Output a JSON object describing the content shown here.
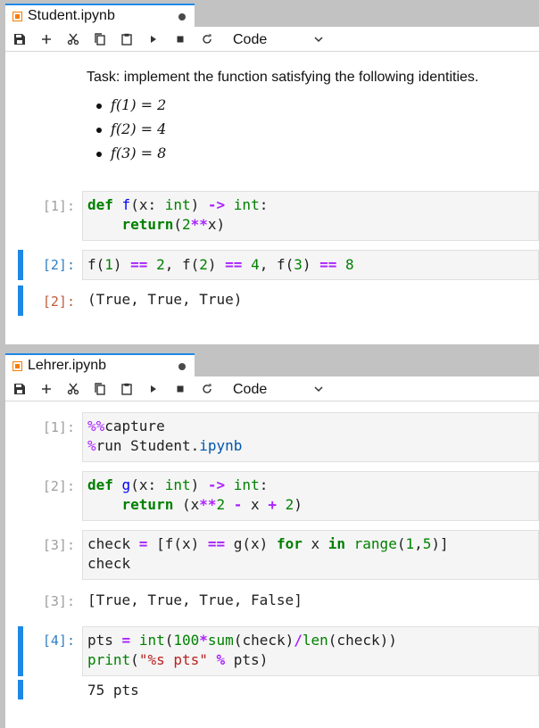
{
  "top": {
    "tab": {
      "label": "Student.ipynb"
    },
    "celltype": "Code",
    "markdown": {
      "task": "Task: implement the function satisfying the following identities.",
      "items": [
        "f(1) = 2",
        "f(2) = 4",
        "f(3) = 8"
      ]
    },
    "cells": [
      {
        "prompt": "[1]:",
        "lines": [
          "def f(x: int) -> int:",
          "    return(2**x)"
        ]
      },
      {
        "prompt": "[2]:",
        "lines": [
          "f(1) == 2, f(2) == 4, f(3) == 8"
        ],
        "out_prompt": "[2]:",
        "output": "(True, True, True)"
      }
    ]
  },
  "bottom": {
    "tab": {
      "label": "Lehrer.ipynb"
    },
    "celltype": "Code",
    "cells": [
      {
        "prompt": "[1]:",
        "lines": [
          "%%capture",
          "%run Student.ipynb"
        ]
      },
      {
        "prompt": "[2]:",
        "lines": [
          "def g(x: int) -> int:",
          "    return (x**2 - x + 2)"
        ]
      },
      {
        "prompt": "[3]:",
        "lines": [
          "check = [f(x) == g(x) for x in range(1,5)]",
          "check"
        ],
        "out_prompt": "[3]:",
        "output": "[True, True, True, False]"
      },
      {
        "prompt": "[4]:",
        "lines": [
          "pts = int(100*sum(check)/len(check))",
          "print(\"%s pts\" % pts)"
        ],
        "output": "75 pts"
      }
    ]
  },
  "toolbar_icons": [
    "save-icon",
    "add-icon",
    "cut-icon",
    "copy-icon",
    "paste-icon",
    "run-icon",
    "stop-icon",
    "restart-icon",
    "chevron-down-icon"
  ],
  "colors": {
    "accent": "#1e88e5",
    "kernel_dot": "#4a4a4a",
    "file_icon": "#f57c00"
  }
}
